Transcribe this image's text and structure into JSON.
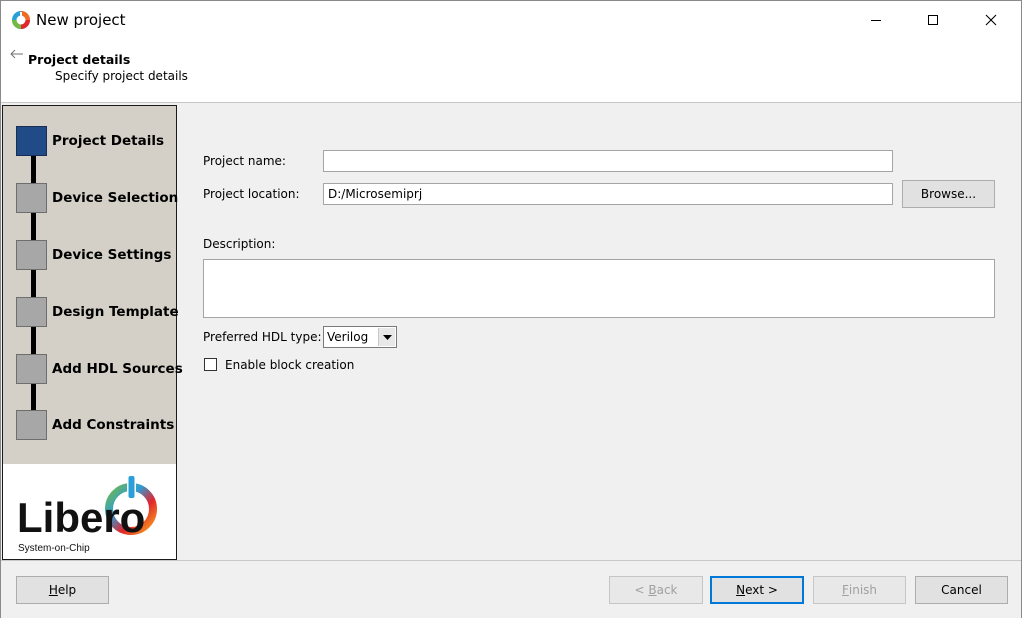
{
  "window": {
    "title": "New project",
    "controls": [
      "minimize",
      "maximize",
      "close"
    ]
  },
  "header": {
    "title": "Project details",
    "subtitle": "Specify project details"
  },
  "sidebar": {
    "steps": [
      {
        "label": "Project Details",
        "active": true
      },
      {
        "label": "Device Selection",
        "active": false
      },
      {
        "label": "Device Settings",
        "active": false
      },
      {
        "label": "Design Template",
        "active": false
      },
      {
        "label": "Add HDL Sources",
        "active": false
      },
      {
        "label": "Add Constraints",
        "active": false
      }
    ],
    "logo": {
      "name": "Libero",
      "tagline": "System-on-Chip"
    }
  },
  "form": {
    "project_name_label": "Project name:",
    "project_name_value": "",
    "project_location_label": "Project location:",
    "project_location_value": "D:/Microsemiprj",
    "browse_label": "Browse...",
    "description_label": "Description:",
    "description_value": "",
    "hdl_label": "Preferred HDL type:",
    "hdl_value": "Verilog",
    "block_creation_label": "Enable block creation",
    "block_creation_checked": false
  },
  "footer": {
    "help": {
      "label": "Help",
      "mnemonic": "H",
      "rest": "elp"
    },
    "back": {
      "prefix": "< ",
      "mnemonic": "B",
      "rest": "ack"
    },
    "next": {
      "mnemonic": "N",
      "rest": "ext >"
    },
    "finish": {
      "mnemonic": "F",
      "rest": "inish"
    },
    "cancel": {
      "label": "Cancel"
    }
  },
  "colors": {
    "active_step": "#214b87",
    "inactive_step": "#a7a7a7",
    "default_button_border": "#0078d7"
  }
}
